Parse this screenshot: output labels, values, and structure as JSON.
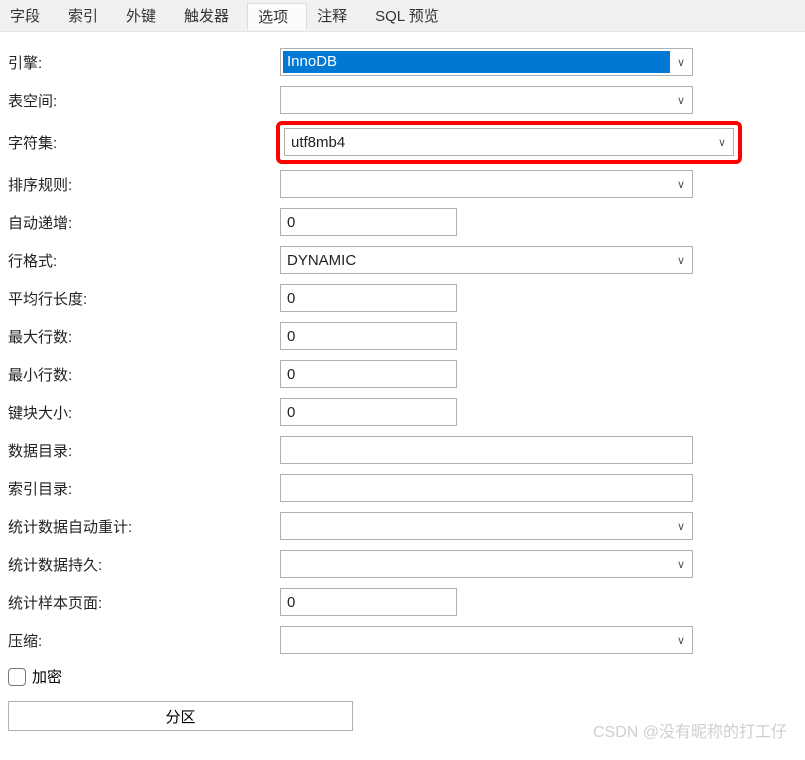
{
  "tabs": {
    "fields": "字段",
    "indexes": "索引",
    "foreign_keys": "外键",
    "triggers": "触发器",
    "options": "选项",
    "comment": "注释",
    "sql_preview": "SQL 预览"
  },
  "labels": {
    "engine": "引擎:",
    "tablespace": "表空间:",
    "charset": "字符集:",
    "collation": "排序规则:",
    "auto_increment": "自动递增:",
    "row_format": "行格式:",
    "avg_row_length": "平均行长度:",
    "max_rows": "最大行数:",
    "min_rows": "最小行数:",
    "key_block_size": "键块大小:",
    "data_directory": "数据目录:",
    "index_directory": "索引目录:",
    "stats_auto_recalc": "统计数据自动重计:",
    "stats_persistent": "统计数据持久:",
    "stats_sample_pages": "统计样本页面:",
    "compression": "压缩:",
    "encryption": "加密",
    "partition": "分区"
  },
  "values": {
    "engine": "InnoDB",
    "tablespace": "",
    "charset": "utf8mb4",
    "collation": "",
    "auto_increment": "0",
    "row_format": "DYNAMIC",
    "avg_row_length": "0",
    "max_rows": "0",
    "min_rows": "0",
    "key_block_size": "0",
    "data_directory": "",
    "index_directory": "",
    "stats_auto_recalc": "",
    "stats_persistent": "",
    "stats_sample_pages": "0",
    "compression": ""
  },
  "watermark": "CSDN @没有昵称的打工仔"
}
